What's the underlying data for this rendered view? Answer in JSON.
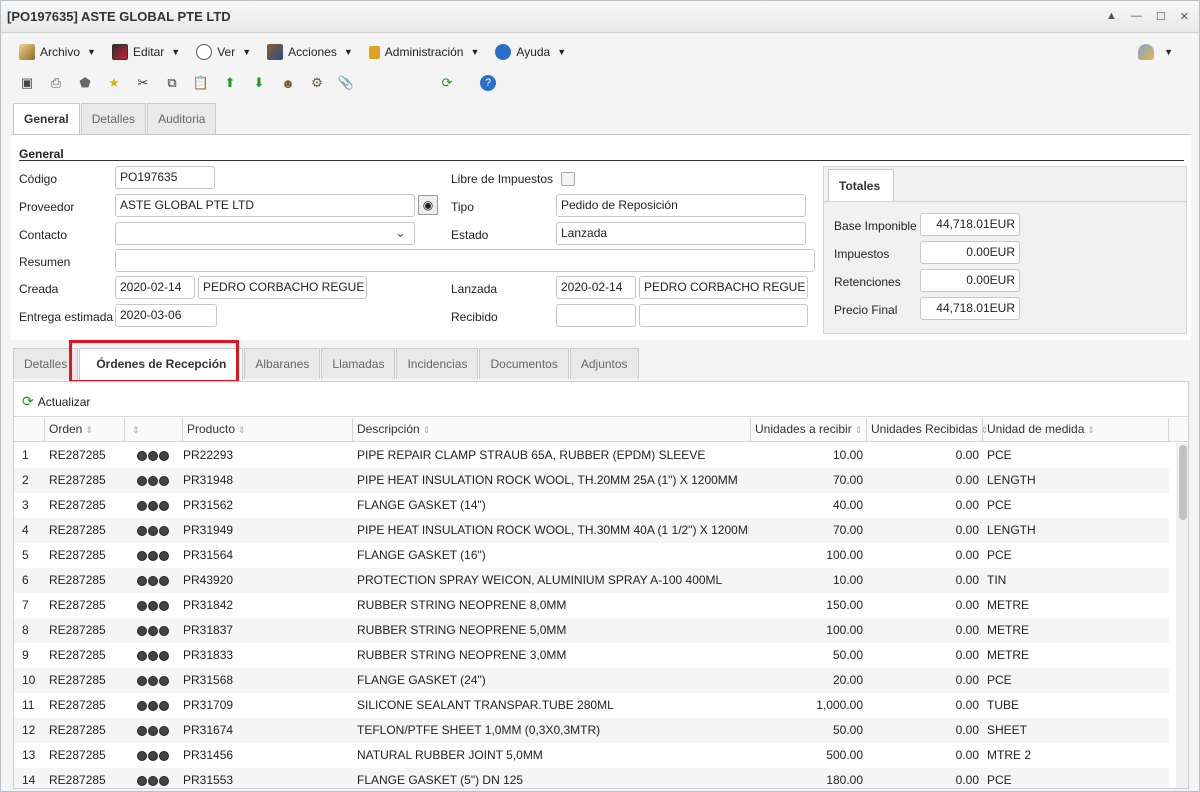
{
  "window": {
    "title": "[PO197635] ASTE GLOBAL PTE LTD",
    "controls": [
      "▲",
      "—",
      "☐",
      "✕"
    ]
  },
  "menu": [
    {
      "label": "Archivo",
      "icon": "archive-icon"
    },
    {
      "label": "Editar",
      "icon": "edit-icon"
    },
    {
      "label": "Ver",
      "icon": "view-icon"
    },
    {
      "label": "Acciones",
      "icon": "actions-icon"
    },
    {
      "label": "Administración",
      "icon": "lock-icon"
    },
    {
      "label": "Ayuda",
      "icon": "help-icon"
    }
  ],
  "toolbar": [
    "save-icon",
    "print-icon",
    "delete-icon",
    "favorite-icon",
    "cut-icon",
    "copy-icon",
    "paste-icon",
    "upload-icon",
    "download-icon",
    "users-icon",
    "settings-icon",
    "attach-icon",
    "refresh-icon",
    "help-icon"
  ],
  "top_tabs": [
    "General",
    "Detalles",
    "Auditoria"
  ],
  "form": {
    "section_title": "General",
    "codigo_label": "Código",
    "codigo": "PO197635",
    "proveedor_label": "Proveedor",
    "proveedor": "ASTE GLOBAL PTE LTD",
    "contacto_label": "Contacto",
    "contacto": "",
    "resumen_label": "Resumen",
    "resumen": "",
    "creada_label": "Creada",
    "creada_fecha": "2020-02-14",
    "creada_usuario": "PEDRO CORBACHO REGUE",
    "entrega_label": "Entrega estimada",
    "entrega": "2020-03-06",
    "libre_label": "Libre de Impuestos",
    "tipo_label": "Tipo",
    "tipo": "Pedido de Reposición",
    "estado_label": "Estado",
    "estado": "Lanzada",
    "lanzada_label": "Lanzada",
    "lanzada_fecha": "2020-02-14",
    "lanzada_usuario": "PEDRO CORBACHO REGUE",
    "recibido_label": "Recibido",
    "recibido_fecha": "",
    "recibido_usuario": ""
  },
  "totals": {
    "tab": "Totales",
    "base_label": "Base Imponible",
    "base": "44,718.01EUR",
    "impuestos_label": "Impuestos",
    "impuestos": "0.00EUR",
    "retenciones_label": "Retenciones",
    "retenciones": "0.00EUR",
    "final_label": "Precio Final",
    "final": "44,718.01EUR"
  },
  "bottom_tabs": [
    "Detalles",
    "Órdenes de Recepción",
    "Albaranes",
    "Llamadas",
    "Incidencias",
    "Documentos",
    "Adjuntos"
  ],
  "grid": {
    "refresh_label": "Actualizar",
    "columns": [
      "Orden",
      "",
      "Producto",
      "Descripción",
      "Unidades a recibir",
      "Unidades Recibidas",
      "Unidad de medida"
    ],
    "rows": [
      [
        "1",
        "RE287285",
        "PR22293",
        "PIPE REPAIR CLAMP STRAUB 65A, RUBBER (EPDM) SLEEVE",
        "10.00",
        "0.00",
        "PCE"
      ],
      [
        "2",
        "RE287285",
        "PR31948",
        "PIPE HEAT INSULATION ROCK WOOL, TH.20MM 25A (1\") X 1200MM",
        "70.00",
        "0.00",
        "LENGTH"
      ],
      [
        "3",
        "RE287285",
        "PR31562",
        "FLANGE GASKET (14\")",
        "40.00",
        "0.00",
        "PCE"
      ],
      [
        "4",
        "RE287285",
        "PR31949",
        "PIPE HEAT INSULATION ROCK WOOL, TH.30MM 40A (1 1/2\") X 1200MM",
        "70.00",
        "0.00",
        "LENGTH"
      ],
      [
        "5",
        "RE287285",
        "PR31564",
        "FLANGE GASKET (16\")",
        "100.00",
        "0.00",
        "PCE"
      ],
      [
        "6",
        "RE287285",
        "PR43920",
        "PROTECTION SPRAY WEICON, ALUMINIUM SPRAY A-100 400ML",
        "10.00",
        "0.00",
        "TIN"
      ],
      [
        "7",
        "RE287285",
        "PR31842",
        "RUBBER STRING NEOPRENE 8,0MM",
        "150.00",
        "0.00",
        "METRE"
      ],
      [
        "8",
        "RE287285",
        "PR31837",
        "RUBBER STRING NEOPRENE 5,0MM",
        "100.00",
        "0.00",
        "METRE"
      ],
      [
        "9",
        "RE287285",
        "PR31833",
        "RUBBER STRING NEOPRENE 3,0MM",
        "50.00",
        "0.00",
        "METRE"
      ],
      [
        "10",
        "RE287285",
        "PR31568",
        "FLANGE GASKET (24\")",
        "20.00",
        "0.00",
        "PCE"
      ],
      [
        "11",
        "RE287285",
        "PR31709",
        "SILICONE SEALANT TRANSPAR.TUBE 280ML",
        "1,000.00",
        "0.00",
        "TUBE"
      ],
      [
        "12",
        "RE287285",
        "PR31674",
        "TEFLON/PTFE SHEET 1,0MM (0,3X0,3MTR)",
        "50.00",
        "0.00",
        "SHEET"
      ],
      [
        "13",
        "RE287285",
        "PR31456",
        "NATURAL RUBBER JOINT 5,0MM",
        "500.00",
        "0.00",
        "MTRE 2"
      ],
      [
        "14",
        "RE287285",
        "PR31553",
        "FLANGE GASKET (5\") DN 125",
        "180.00",
        "0.00",
        "PCE"
      ]
    ]
  }
}
